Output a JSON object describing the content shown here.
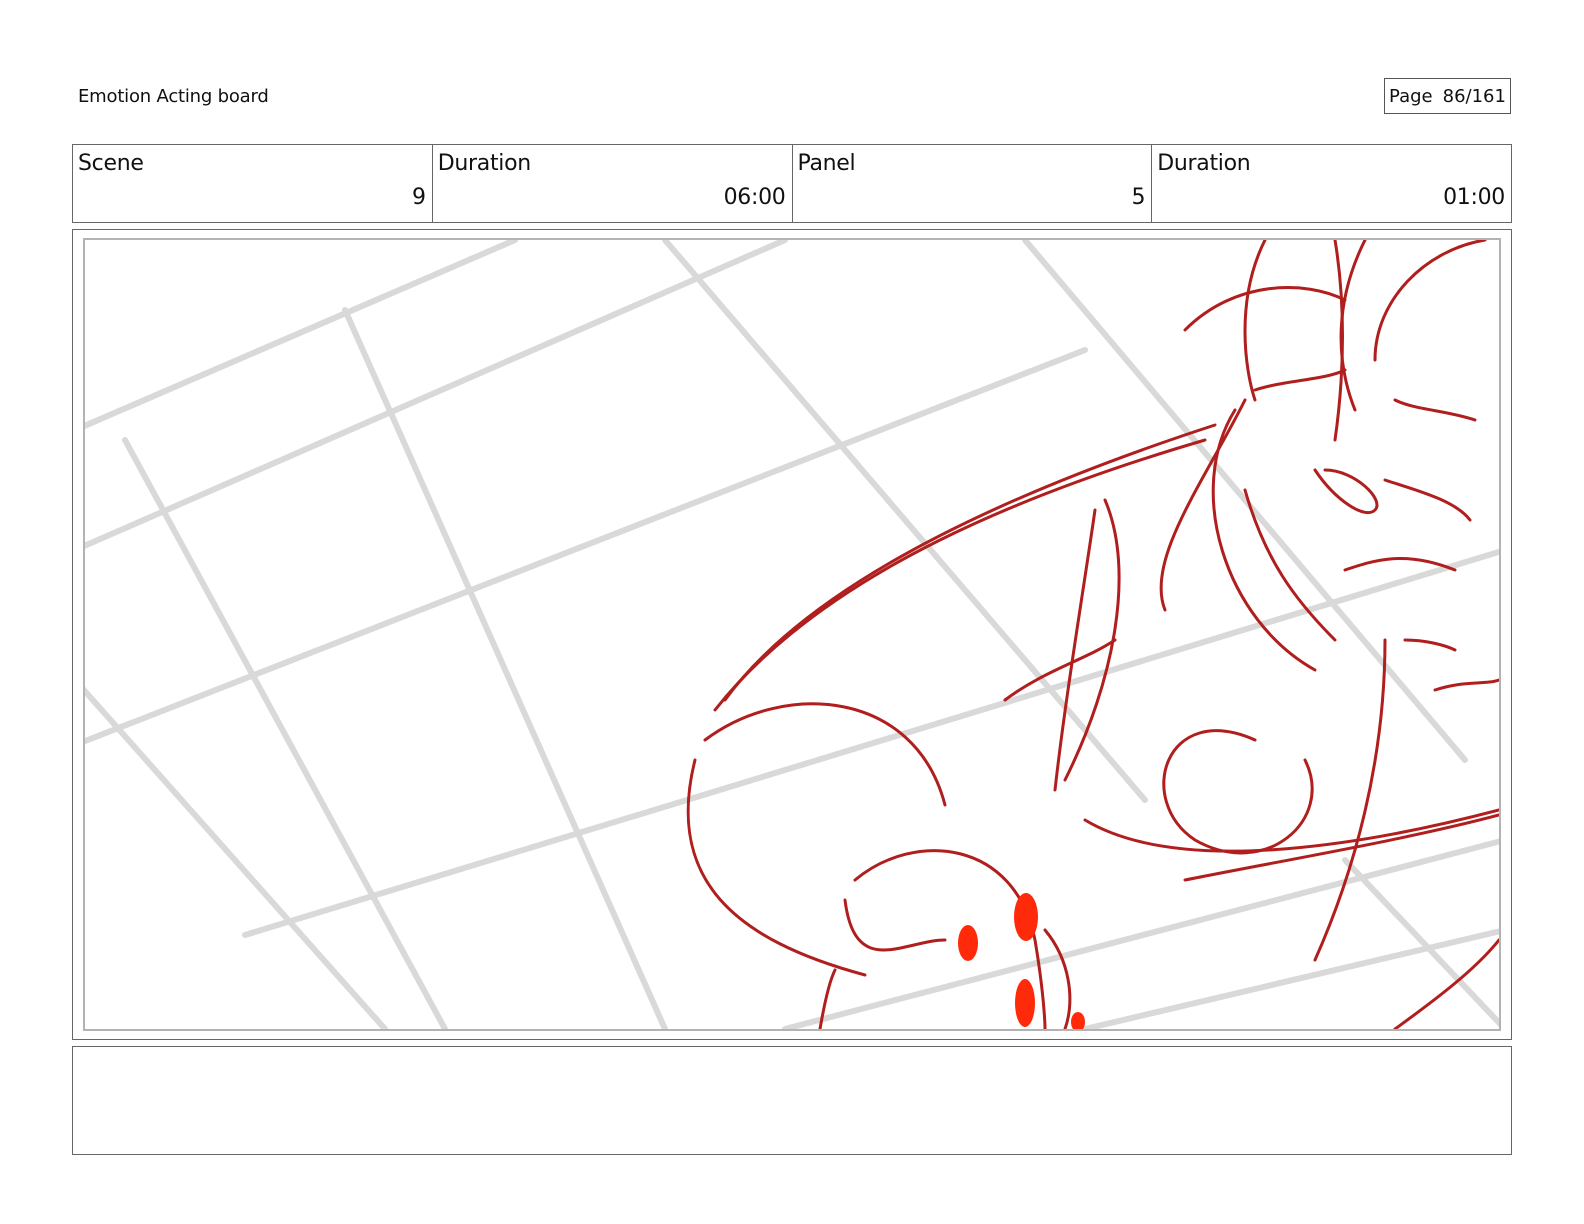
{
  "document": {
    "title": "Emotion Acting board",
    "page_label": "Page",
    "page_number": "86/161"
  },
  "info": {
    "scene_label": "Scene",
    "scene_value": "9",
    "scene_duration_label": "Duration",
    "scene_duration_value": "06:00",
    "panel_label": "Panel",
    "panel_value": "5",
    "panel_duration_label": "Duration",
    "panel_duration_value": "01:00"
  },
  "caption": {
    "text": ""
  },
  "colors": {
    "sketch_line": "#b01e1e",
    "sketch_fill": "#ff2a0a",
    "grid_line": "#d9d9d9",
    "border": "#666666"
  }
}
